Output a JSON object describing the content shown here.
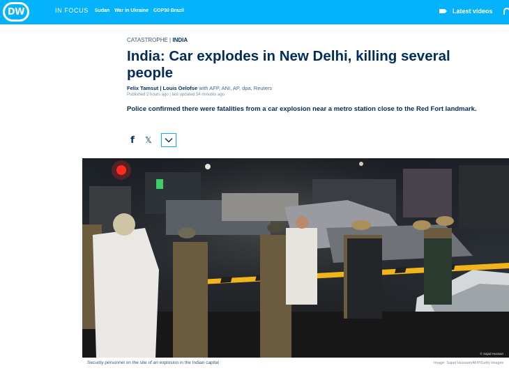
{
  "header": {
    "logo_text": "DW",
    "in_focus": "IN FOCUS",
    "nav_links": [
      "Sudan",
      "War in Ukraine",
      "COP30 Brazil"
    ],
    "latest_videos": "Latest videos"
  },
  "article": {
    "kicker_category": "CATASTROPHE |",
    "kicker_region": "INDIA",
    "title": "India: Car explodes in New Delhi, killing several people",
    "byline_authors": "Felix Tamsut | Louis Oelofse",
    "byline_agencies": "with AFP, ANI, AP, dpa, Reuters",
    "published": "Published 2 hours ago | last updated 54 minutes ago",
    "teaser": "Police confirmed there were fatalities from a car explosion near a metro station close to the Red Fort landmark."
  },
  "share": {
    "facebook_icon": "f",
    "x_icon": "𝕏"
  },
  "photo": {
    "watermark": "© Sajad Hussain",
    "caption": "Security personnel on the site of an explosion in the Indian capital",
    "credit": "Image: Sajad Hussain/AFP/Getty Images"
  },
  "colors": {
    "brand_blue": "#05b2fc",
    "dw_navy": "#002d5a",
    "tape_yellow": "#f2b41b"
  }
}
